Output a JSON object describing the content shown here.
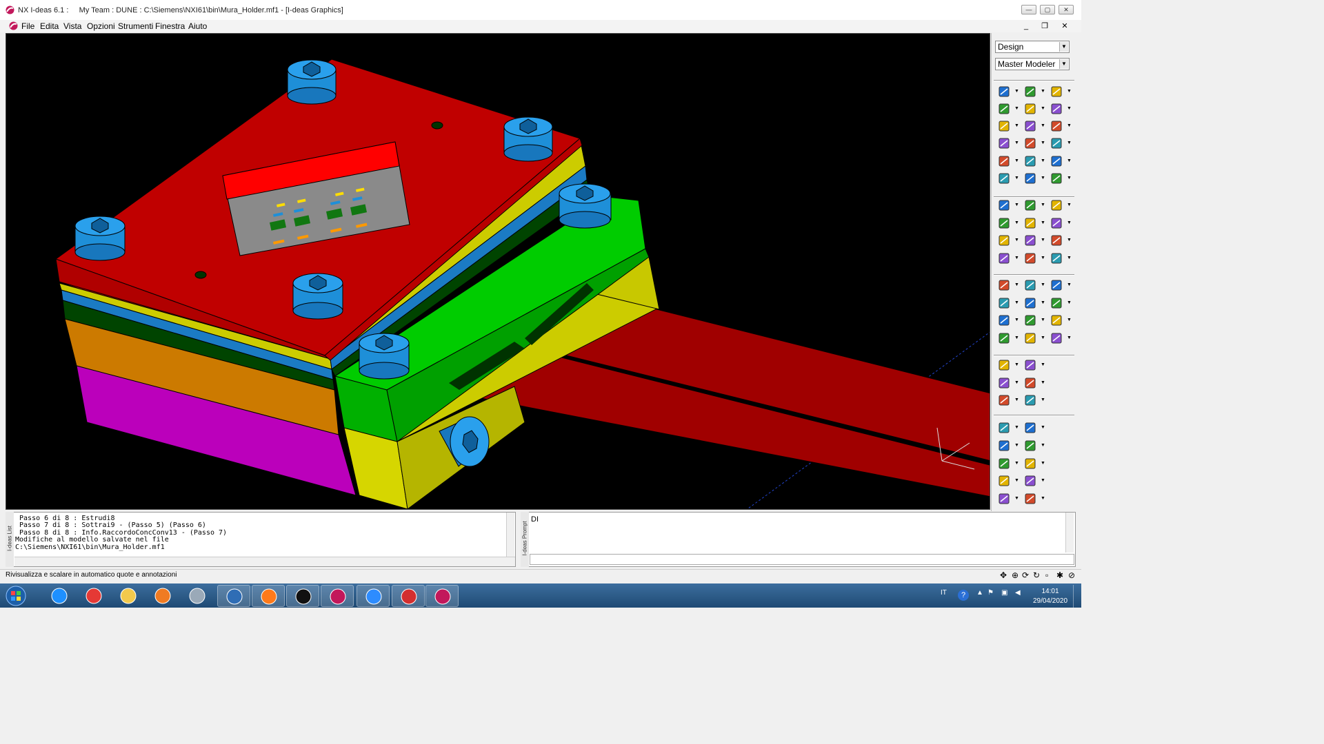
{
  "window": {
    "title": "NX I-deas 6.1 :     My Team : DUNE : C:\\Siemens\\NXI61\\bin\\Mura_Holder.mf1 - [I-deas Graphics]",
    "app_icon": "ideas-app-icon"
  },
  "menu": {
    "items": [
      "File",
      "Edita",
      "Vista",
      "Opzioni",
      "Strumenti",
      "Finestra",
      "Aiuto"
    ]
  },
  "panel": {
    "task_select": "Design",
    "application_select": "Master Modeler"
  },
  "model": {
    "colors": {
      "top_plate": "#cc0000",
      "green_block": "#00bb00",
      "yellow_block": "#cccc00",
      "orange_layer": "#cc7a00",
      "magenta_layer": "#bb00bb",
      "blue_layer": "#1b7bc4",
      "screws": "#1e8fd8",
      "strips": "#a00000",
      "label_body": "#8a8a8a",
      "label_header": "#ff0000"
    }
  },
  "list_pane": {
    "label": "I-deas List",
    "lines": [
      " Passo 6 di 8 : Estrudi8",
      " Passo 7 di 8 : Sottrai9 - (Passo 5) (Passo 6)",
      " Passo 8 di 8 : Info.RaccordoConcConv13 - (Passo 7)",
      "Modifiche al modello salvate nel file",
      "C:\\Siemens\\NXI61\\bin\\Mura_Holder.mf1"
    ]
  },
  "prompt_pane": {
    "label": "I-deas Prompt",
    "text": "DI",
    "input_value": ""
  },
  "status": {
    "text": "Rivisualizza e scalare in automatico quote e annotazioni"
  },
  "taskbar": {
    "apps": [
      "start-button",
      "internet-explorer",
      "chrome",
      "file-explorer",
      "media-player",
      "calculator",
      "thunderbird",
      "firefox",
      "command-prompt",
      "ideas-launcher",
      "zoom",
      "acrobat-reader",
      "ideas-active"
    ],
    "language": "IT",
    "time": "14:01",
    "date": "29/04/2020"
  }
}
